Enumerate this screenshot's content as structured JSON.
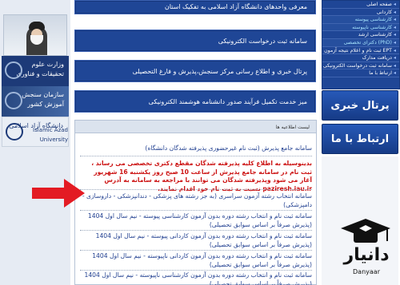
{
  "left_sidebar": {
    "portrait_alt": "",
    "banners": [
      {
        "label": "وزارت علوم\nتحقیقات و فناوری"
      },
      {
        "label": "سازمان سنجش آموزش کشور"
      },
      {
        "label": "دانشگاه آزاد اسلامی",
        "english": "Islamic Azad University"
      }
    ]
  },
  "services": [
    {
      "label": "معرفی واحدهای دانشگاه آزاد اسلامی به تفکیک استان"
    },
    {
      "label": "سامانه ثبت درخواست الکترونیکی"
    },
    {
      "label": "پرتال خبری و اطلاع رسانی مرکز سنجش،پذیرش و فارغ التحصیلی"
    },
    {
      "label": "میز خدمت تکمیل فرآیند صدور دانشنامه هوشمند الکترونیکی"
    }
  ],
  "news": {
    "header": "لیست اطلاعیه ها",
    "items": [
      {
        "text": "سامانه جامع پذیرش (ثبت نام غیرحضوری پذیرفته شدگان دانشگاه)",
        "red": false
      },
      {
        "text": "بدینوسیله به اطلاع کلیه پذیرفته شدگان مقطع دکتری تخصصی می رساند ، ثبت نام در سامانه جامع پذیرش از ساعت 10 صبح روز یکشنبه 16 شهریور آغاز می شود وپذیرفته شدگان می توانند با مراجعه به سامانه به آدرس pazіresh.iau.ir نسبت به ثبت نام خود اقدام نمایند.",
        "red": true
      },
      {
        "text": "سامانه انتخاب رشته آزمون سراسری (به جز رشته های پزشکی - دندانپزشکی - داروسازی - دامپزشکی)",
        "red": false
      },
      {
        "text": "سامانه ثبت نام و انتخاب رشته دوره بدون آزمون کارشناسی پیوسته - نیم سال اول 1404 (پذیرش صرفاً بر اساس سوابق تحصیلی)",
        "red": false
      },
      {
        "text": "سامانه ثبت نام و انتخاب رشته دوره بدون آزمون کاردانی پیوسته - نیم سال اول 1404 (پذیرش صرفاً بر اساس سوابق تحصیلی)",
        "red": false
      },
      {
        "text": "سامانه ثبت نام و انتخاب رشته دوره بدون آزمون کاردانی ناپیوسته - نیم سال اول 1404 (پذیرش صرفاً بر اساس سوابق تحصیلی)",
        "red": false
      },
      {
        "text": "سامانه ثبت نام و انتخاب رشته دوره بدون آزمون کارشناسی ناپیوسته - نیم سال اول 1404 (پذیرش صرفاً بر اساس سوابق تحصیلی)",
        "red": false
      }
    ]
  },
  "right_menu": {
    "items": [
      {
        "label": "صفحه اصلی",
        "alt": false
      },
      {
        "label": "کاردانی",
        "alt": false
      },
      {
        "label": "کارشناسی پیوسته",
        "alt": true
      },
      {
        "label": "کارشناسی ناپیوسته",
        "alt": true
      },
      {
        "label": "کارشناسی ارشد",
        "alt": false
      },
      {
        "label": "دکترای تخصصی (PhD)",
        "alt": true
      },
      {
        "label": "ثبت نام و اعلام نتیجه آزمون EPT",
        "alt": false
      },
      {
        "label": "دریافت مدارک",
        "alt": false
      },
      {
        "label": "سامانه ثبت درخواست الکترونیکی",
        "alt": false
      },
      {
        "label": "ارتباط با ما",
        "alt": false
      }
    ],
    "banners": [
      {
        "label": "پرتال خبری"
      },
      {
        "label": "ارتباط با ما"
      }
    ]
  },
  "watermark": {
    "title": "دانیار",
    "subtitle": "Danyaar"
  },
  "colors": {
    "primary_blue": "#1f4696",
    "link_blue": "#1e3d8f",
    "notice_red": "#cc1111",
    "arrow_red": "#e31b23"
  }
}
